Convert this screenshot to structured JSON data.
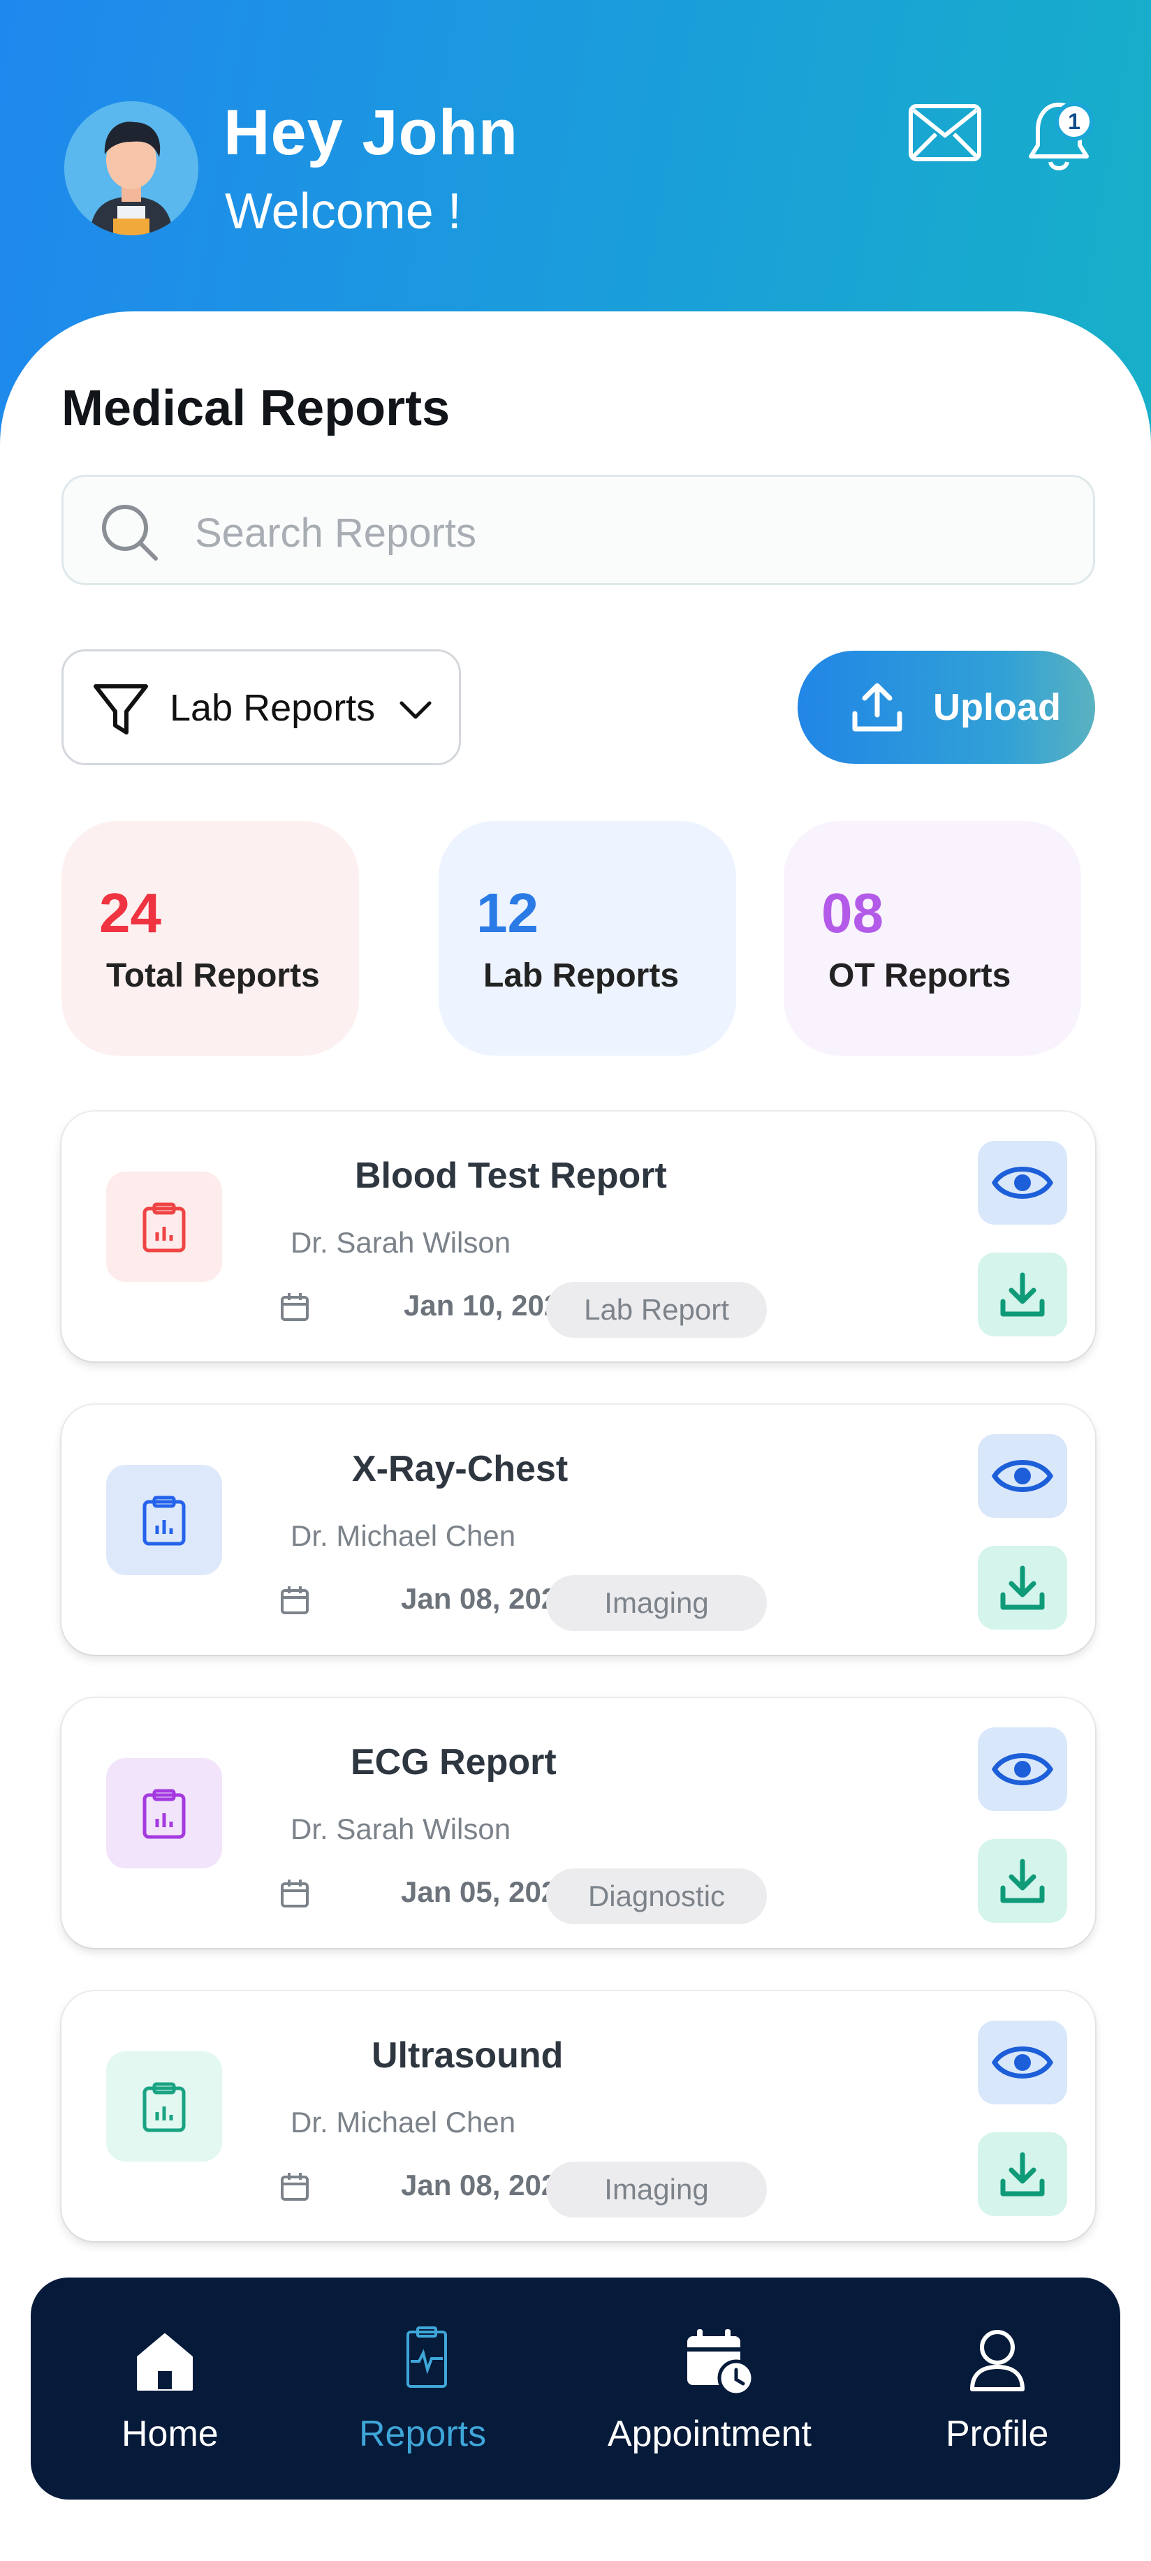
{
  "header": {
    "greeting": "Hey John",
    "subtitle": "Welcome !",
    "notification_count": "1",
    "gradient_start": "#1f88ee",
    "gradient_end": "#17b0c8"
  },
  "main": {
    "title": "Medical Reports",
    "search": {
      "placeholder": "Search Reports",
      "value": "",
      "icon": "search-icon"
    },
    "filter": {
      "selected": "Lab Reports",
      "icon": "filter-icon"
    },
    "upload": {
      "label": "Upload",
      "icon": "upload-icon"
    }
  },
  "stats": [
    {
      "value": "24",
      "label": "Total Reports",
      "color": "#ef3340",
      "bg": "#fdf0f0"
    },
    {
      "value": "12",
      "label": "Lab Reports",
      "color": "#2b7be6",
      "bg": "#edf4ff"
    },
    {
      "value": "08",
      "label": "OT Reports",
      "color": "#b35be8",
      "bg": "#f8f3fd"
    }
  ],
  "reports": [
    {
      "title": "Blood Test Report",
      "doctor": "Dr. Sarah Wilson",
      "date": "Jan 10, 2026",
      "tag": "Lab Report",
      "icon_color": "#ef4444",
      "icon_bg": "#fdeceb"
    },
    {
      "title": "X-Ray-Chest",
      "doctor": "Dr. Michael Chen",
      "date": "Jan 08, 2026",
      "tag": "Imaging",
      "icon_color": "#2563eb",
      "icon_bg": "#dde9fb"
    },
    {
      "title": "ECG Report",
      "doctor": "Dr. Sarah Wilson",
      "date": "Jan 05, 2026",
      "tag": "Diagnostic",
      "icon_color": "#a43ae0",
      "icon_bg": "#f1e4fb"
    },
    {
      "title": "Ultrasound",
      "doctor": "Dr. Michael Chen",
      "date": "Jan 08, 2026",
      "tag": "Imaging",
      "icon_color": "#1aa383",
      "icon_bg": "#e2f8f1"
    }
  ],
  "nav": [
    {
      "label": "Home",
      "icon": "home-icon",
      "active": false
    },
    {
      "label": "Reports",
      "icon": "reports-icon",
      "active": true
    },
    {
      "label": "Appointment",
      "icon": "calendar-clock-icon",
      "active": false
    },
    {
      "label": "Profile",
      "icon": "user-icon",
      "active": false
    }
  ],
  "colors": {
    "nav_bg": "#061a3a",
    "nav_active": "#3fa6d8",
    "view_icon": "#1d5fd8",
    "download_icon": "#0f9a78"
  }
}
